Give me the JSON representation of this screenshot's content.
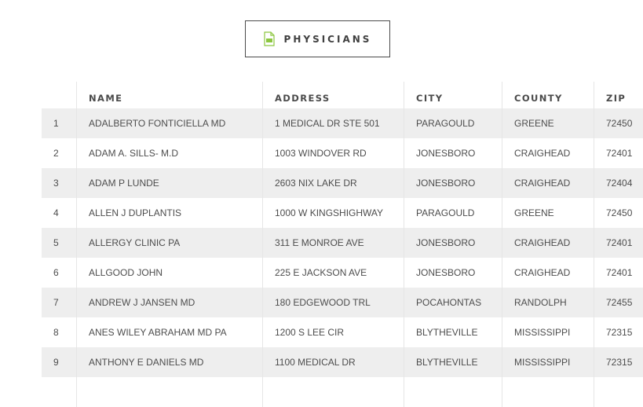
{
  "export": {
    "label": "PHYSICIANS",
    "icon": "csv-file-icon",
    "icon_color": "#8cc63f"
  },
  "table": {
    "headers": {
      "num": "",
      "name": "NAME",
      "address": "ADDRESS",
      "city": "CITY",
      "county": "COUNTY",
      "zip": "ZIP"
    },
    "rows": [
      {
        "num": "1",
        "name": "ADALBERTO FONTICIELLA MD",
        "address": "1 MEDICAL DR STE 501",
        "city": "PARAGOULD",
        "county": "GREENE",
        "zip": "72450"
      },
      {
        "num": "2",
        "name": "ADAM A. SILLS- M.D",
        "address": "1003 WINDOVER RD",
        "city": "JONESBORO",
        "county": "CRAIGHEAD",
        "zip": "72401"
      },
      {
        "num": "3",
        "name": "ADAM P LUNDE",
        "address": "2603 NIX LAKE DR",
        "city": "JONESBORO",
        "county": "CRAIGHEAD",
        "zip": "72404"
      },
      {
        "num": "4",
        "name": "ALLEN J DUPLANTIS",
        "address": "1000 W KINGSHIGHWAY",
        "city": "PARAGOULD",
        "county": "GREENE",
        "zip": "72450"
      },
      {
        "num": "5",
        "name": "ALLERGY CLINIC PA",
        "address": "311 E MONROE AVE",
        "city": "JONESBORO",
        "county": "CRAIGHEAD",
        "zip": "72401"
      },
      {
        "num": "6",
        "name": "ALLGOOD JOHN",
        "address": "225 E JACKSON AVE",
        "city": "JONESBORO",
        "county": "CRAIGHEAD",
        "zip": "72401"
      },
      {
        "num": "7",
        "name": "ANDREW J JANSEN MD",
        "address": "180 EDGEWOOD TRL",
        "city": "POCAHONTAS",
        "county": "RANDOLPH",
        "zip": "72455"
      },
      {
        "num": "8",
        "name": "ANES WILEY ABRAHAM MD PA",
        "address": "1200 S LEE CIR",
        "city": "BLYTHEVILLE",
        "county": "MISSISSIPPI",
        "zip": "72315"
      },
      {
        "num": "9",
        "name": "ANTHONY E DANIELS MD",
        "address": "1100 MEDICAL DR",
        "city": "BLYTHEVILLE",
        "county": "MISSISSIPPI",
        "zip": "72315"
      },
      {
        "num": "",
        "name": "",
        "address": "",
        "city": "",
        "county": "",
        "zip": ""
      }
    ]
  }
}
